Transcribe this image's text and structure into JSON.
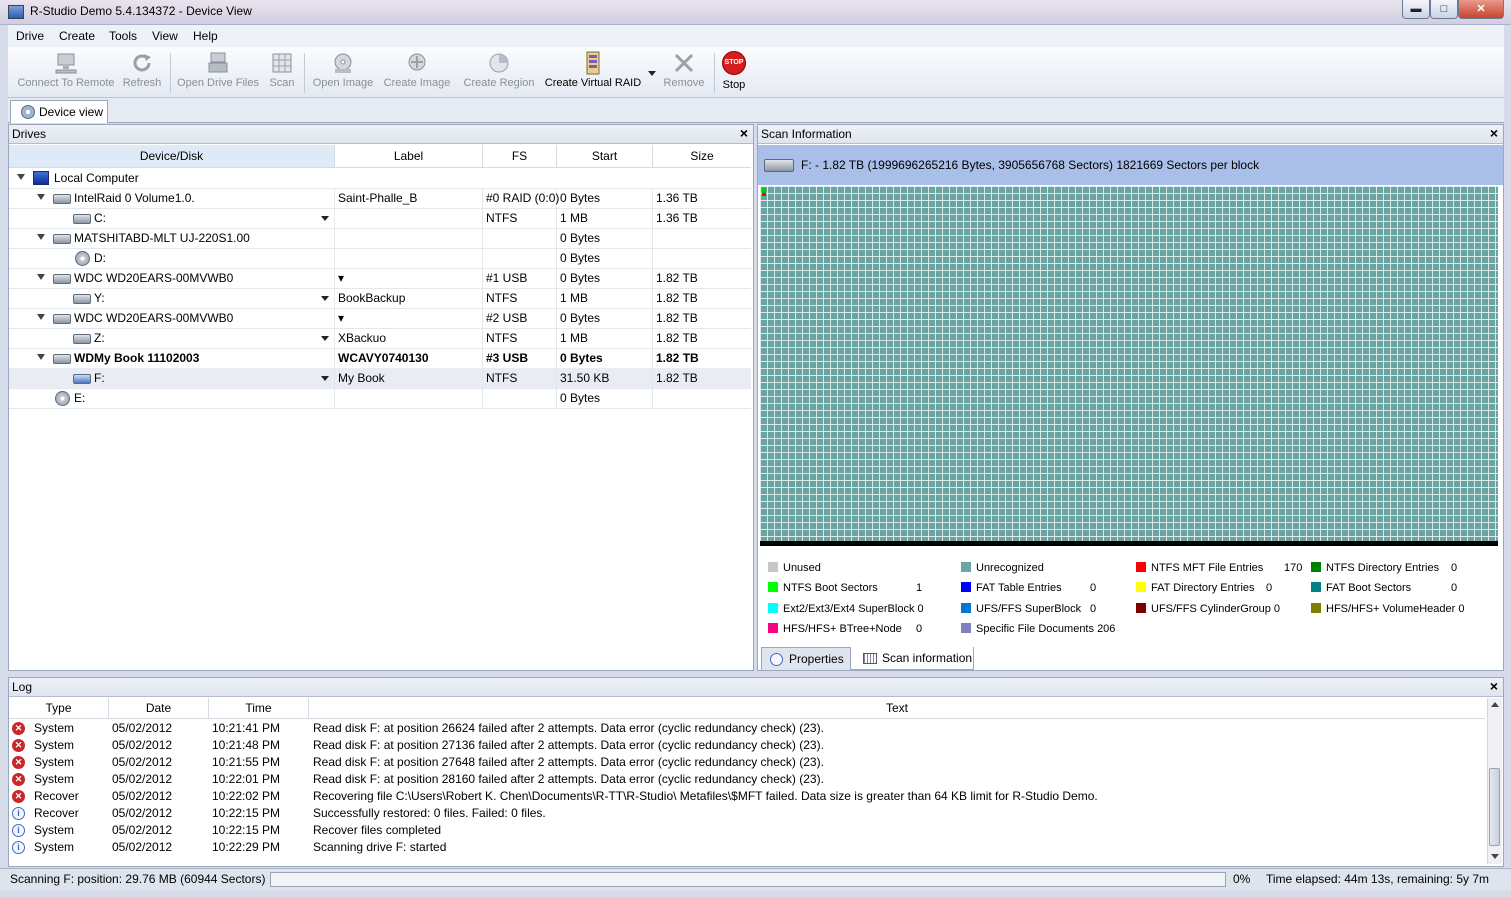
{
  "window": {
    "title": "R-Studio Demo 5.4.134372 - Device View",
    "min": "▬",
    "max": "□",
    "close": "✕"
  },
  "menu": [
    "Drive",
    "Create",
    "Tools",
    "View",
    "Help"
  ],
  "toolbar": {
    "connect": "Connect To Remote",
    "refresh": "Refresh",
    "open_drive_files": "Open Drive Files",
    "scan": "Scan",
    "open_image": "Open Image",
    "create_image": "Create Image",
    "create_region": "Create Region",
    "create_virtual_raid": "Create Virtual RAID",
    "remove": "Remove",
    "stop": "Stop",
    "stop_icon_text": "STOP"
  },
  "doc_tab": {
    "label": "Device view"
  },
  "drives": {
    "title": "Drives",
    "columns": {
      "device": "Device/Disk",
      "label": "Label",
      "fs": "FS",
      "start": "Start",
      "size": "Size"
    },
    "rows": [
      {
        "device": "Local Computer",
        "label": "",
        "fs": "",
        "start": "",
        "size": ""
      },
      {
        "device": "IntelRaid 0 Volume1.0.",
        "label": "Saint-Phalle_B",
        "fs": "#0 RAID (0:0)",
        "start": "0 Bytes",
        "size": "1.36 TB"
      },
      {
        "device": "C:",
        "label": "",
        "fs": "NTFS",
        "start": "1 MB",
        "size": "1.36 TB"
      },
      {
        "device": "MATSHITABD-MLT UJ-220S1.00",
        "label": "",
        "fs": "",
        "start": "0 Bytes",
        "size": ""
      },
      {
        "device": "D:",
        "label": "",
        "fs": "",
        "start": "0 Bytes",
        "size": ""
      },
      {
        "device": "WDC WD20EARS-00MVWB0",
        "label": "▾",
        "fs": "#1 USB",
        "start": "0 Bytes",
        "size": "1.82 TB"
      },
      {
        "device": "Y:",
        "label": "BookBackup",
        "fs": "NTFS",
        "start": "1 MB",
        "size": "1.82 TB"
      },
      {
        "device": "WDC WD20EARS-00MVWB0",
        "label": "▾",
        "fs": "#2 USB",
        "start": "0 Bytes",
        "size": "1.82 TB"
      },
      {
        "device": "Z:",
        "label": "XBackuo",
        "fs": "NTFS",
        "start": "1 MB",
        "size": "1.82 TB"
      },
      {
        "device": "WDMy Book 11102003",
        "label": "WCAVY0740130",
        "fs": "#3 USB",
        "start": "0 Bytes",
        "size": "1.82 TB"
      },
      {
        "device": "F:",
        "label": "My Book",
        "fs": "NTFS",
        "start": "31.50 KB",
        "size": "1.82 TB"
      },
      {
        "device": "E:",
        "label": "",
        "fs": "",
        "start": "0 Bytes",
        "size": ""
      }
    ]
  },
  "scan": {
    "title": "Scan Information",
    "drive_info": "F: - 1.82 TB (1999696265216 Bytes, 3905656768 Sectors) 1821669 Sectors per block",
    "legend": [
      {
        "name": "Unused",
        "color": "#c6c6c6",
        "count": ""
      },
      {
        "name": "Unrecognized",
        "color": "#6aa5a4",
        "count": ""
      },
      {
        "name": "NTFS MFT File Entries",
        "color": "#ff0000",
        "count": "170"
      },
      {
        "name": "NTFS Directory Entries",
        "color": "#008000",
        "count": "0"
      },
      {
        "name": "NTFS Boot Sectors",
        "color": "#00ff00",
        "count": "1"
      },
      {
        "name": "FAT Table Entries",
        "color": "#0000ff",
        "count": "0"
      },
      {
        "name": "FAT Directory Entries",
        "color": "#ffff00",
        "count": "0"
      },
      {
        "name": "FAT Boot Sectors",
        "color": "#008080",
        "count": "0"
      },
      {
        "name": "Ext2/Ext3/Ext4 SuperBlock",
        "color": "#00ffff",
        "count": "0"
      },
      {
        "name": "UFS/FFS SuperBlock",
        "color": "#0078d7",
        "count": "0"
      },
      {
        "name": "UFS/FFS CylinderGroup",
        "color": "#800000",
        "count": "0"
      },
      {
        "name": "HFS/HFS+ VolumeHeader",
        "color": "#808000",
        "count": "0"
      },
      {
        "name": "HFS/HFS+ BTree+Node",
        "color": "#ff0080",
        "count": "0"
      },
      {
        "name": "Specific File Documents",
        "color": "#8080c0",
        "count": "206"
      }
    ],
    "tabs": {
      "properties": "Properties",
      "scan_information": "Scan information"
    }
  },
  "log": {
    "title": "Log",
    "columns": {
      "type": "Type",
      "date": "Date",
      "time": "Time",
      "text": "Text"
    },
    "rows": [
      {
        "level": "error",
        "type": "System",
        "date": "05/02/2012",
        "time": "10:21:41 PM",
        "text": "Read disk F: at position 26624 failed after 2 attempts. Data error (cyclic redundancy check) (23)."
      },
      {
        "level": "error",
        "type": "System",
        "date": "05/02/2012",
        "time": "10:21:48 PM",
        "text": "Read disk F: at position 27136 failed after 2 attempts. Data error (cyclic redundancy check) (23)."
      },
      {
        "level": "error",
        "type": "System",
        "date": "05/02/2012",
        "time": "10:21:55 PM",
        "text": "Read disk F: at position 27648 failed after 2 attempts. Data error (cyclic redundancy check) (23)."
      },
      {
        "level": "error",
        "type": "System",
        "date": "05/02/2012",
        "time": "10:22:01 PM",
        "text": "Read disk F: at position 28160 failed after 2 attempts. Data error (cyclic redundancy check) (23)."
      },
      {
        "level": "error",
        "type": "Recover",
        "date": "05/02/2012",
        "time": "10:22:02 PM",
        "text": "Recovering file C:\\Users\\Robert K. Chen\\Documents\\R-TT\\R-Studio\\ Metafiles\\$MFT failed. Data size is greater than 64 KB limit for R-Studio Demo."
      },
      {
        "level": "info",
        "type": "Recover",
        "date": "05/02/2012",
        "time": "10:22:15 PM",
        "text": "Successfully restored: 0 files. Failed: 0 files."
      },
      {
        "level": "info",
        "type": "System",
        "date": "05/02/2012",
        "time": "10:22:15 PM",
        "text": "Recover files completed"
      },
      {
        "level": "info",
        "type": "System",
        "date": "05/02/2012",
        "time": "10:22:29 PM",
        "text": "Scanning drive F: started"
      }
    ]
  },
  "status": {
    "scanning": "Scanning F: position: 29.76 MB (60944 Sectors)",
    "progress_percent": "0%",
    "progress_value": 0,
    "elapsed": "Time elapsed: 44m 13s, remaining: 5y 7m"
  }
}
